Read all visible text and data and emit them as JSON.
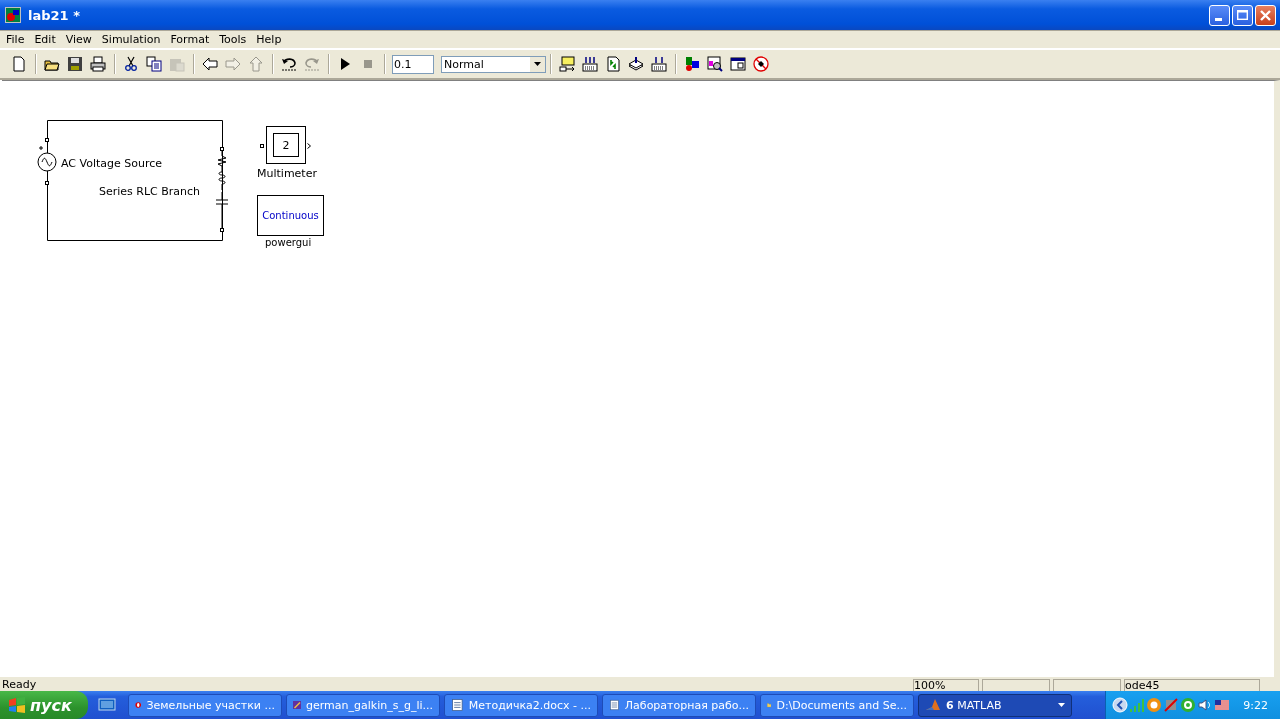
{
  "window": {
    "title": "lab21 *"
  },
  "menu": [
    "File",
    "Edit",
    "View",
    "Simulation",
    "Format",
    "Tools",
    "Help"
  ],
  "toolbar": {
    "buttons": [
      {
        "disabled": false
      },
      {
        "disabled": false
      },
      {
        "disabled": false
      },
      {
        "disabled": false
      },
      {
        "disabled": false
      },
      {
        "disabled": false
      },
      {
        "disabled": true
      },
      {
        "disabled": false
      },
      {
        "disabled": true
      },
      {
        "disabled": true
      },
      {
        "disabled": false
      },
      {
        "disabled": true
      },
      {
        "disabled": false
      },
      {
        "disabled": true
      },
      {
        "disabled": false
      },
      {
        "disabled": false
      },
      {
        "disabled": false
      },
      {
        "disabled": false
      },
      {
        "disabled": false
      },
      {
        "disabled": false
      },
      {
        "disabled": false
      },
      {
        "disabled": false
      },
      {
        "disabled": false
      }
    ],
    "stop_time": "0.1",
    "mode": "Normal"
  },
  "diagram": {
    "source_label": "AC Voltage Source",
    "branch_label": "Series RLC Branch",
    "multimeter_value": "2",
    "multimeter_label": "Multimeter",
    "powergui_value": "Continuous",
    "powergui_label": "powergui"
  },
  "status_bar": {
    "message": "Ready",
    "zoom": "100%",
    "solver": "ode45"
  },
  "taskbar": {
    "start": "пуск",
    "tasks": [
      {
        "label": "Земельные участки ...",
        "selected": false
      },
      {
        "label": "german_galkin_s_g_li...",
        "selected": false
      },
      {
        "label": "Методичка2.docx - ...",
        "selected": false
      },
      {
        "label": "Лабораторная рабо...",
        "selected": false
      },
      {
        "label": "D:\\Documents and Se...",
        "selected": false
      },
      {
        "label": "**6** MATLAB",
        "selected": true
      }
    ],
    "clock": "9:22"
  }
}
